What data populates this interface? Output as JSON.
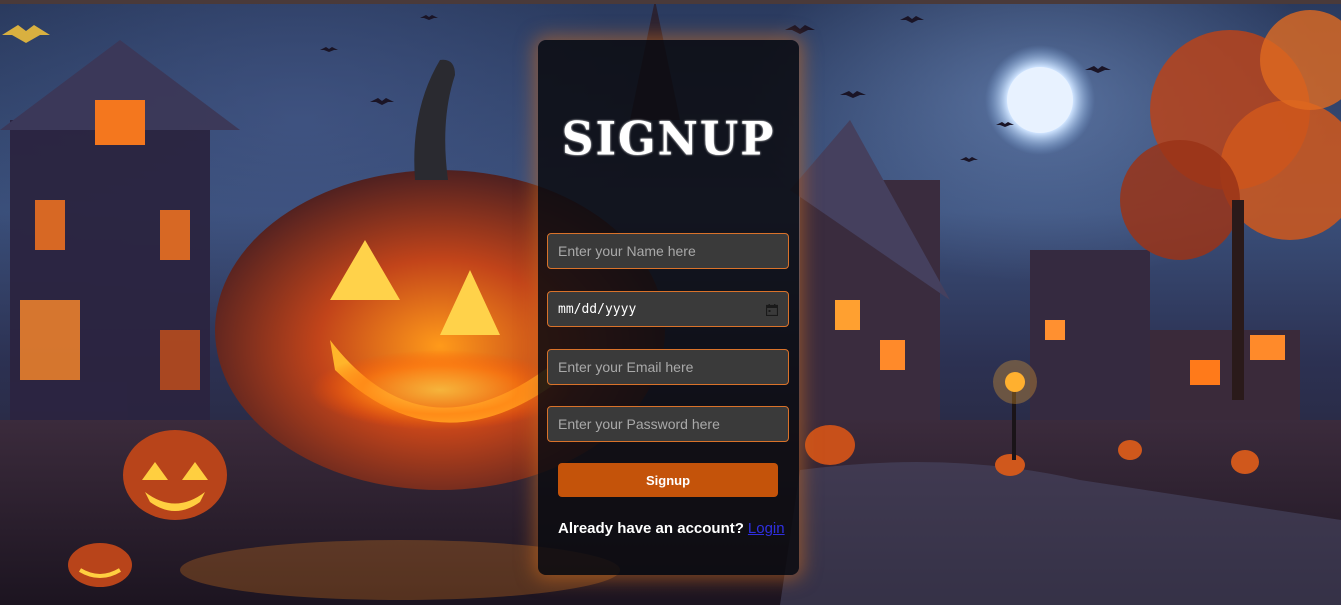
{
  "page": {
    "title": "SIGNUP"
  },
  "form": {
    "name_placeholder": "Enter your Name here",
    "date_value": "mm/dd/yyyy",
    "email_placeholder": "Enter your Email here",
    "password_placeholder": "Enter your Password here",
    "submit_label": "Signup"
  },
  "footer": {
    "prompt": "Already have an account?",
    "login_link": "Login"
  },
  "colors": {
    "accent": "#c4530a",
    "field_border": "#d9722a",
    "card_bg": "#0c0c10",
    "link": "#2f2fe0"
  },
  "icons": {
    "calendar": "calendar-icon"
  }
}
